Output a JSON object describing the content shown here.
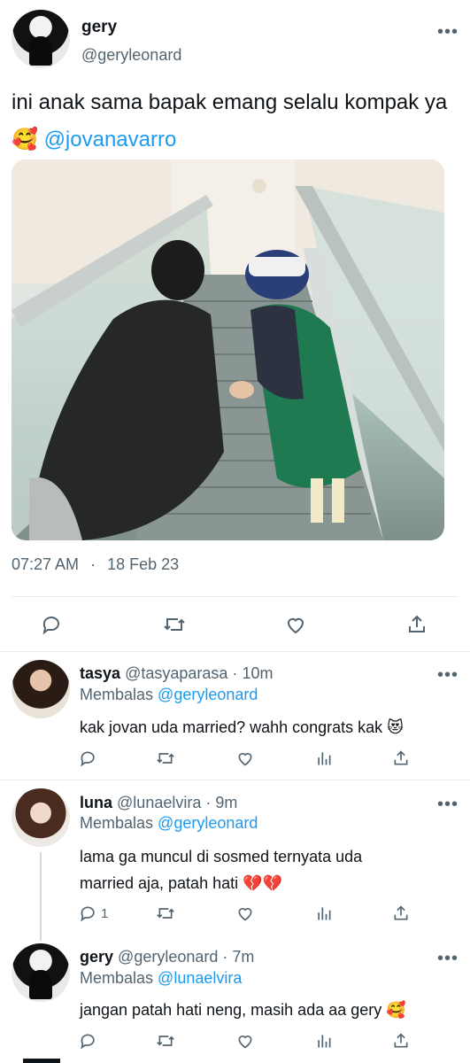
{
  "main_tweet": {
    "name": "gery",
    "handle": "@geryleonard",
    "text": "ini anak sama bapak emang selalu kompak ya 🥰",
    "mention": "@jovanavarro",
    "time": "07:27 AM",
    "separator": "·",
    "date": "18 Feb 23"
  },
  "replies": [
    {
      "name": "tasya",
      "handle": "@tasyaparasa",
      "time_sep": "·",
      "time": "10m",
      "reply_to_label": "Membalas",
      "reply_to": "@geryleonard",
      "text": "kak jovan uda married? wahh congrats kak 😻",
      "reply_count": ""
    },
    {
      "name": "luna",
      "handle": "@lunaelvira",
      "time_sep": "·",
      "time": "9m",
      "reply_to_label": "Membalas",
      "reply_to": "@geryleonard",
      "text": "lama ga muncul di sosmed ternyata uda married aja, patah hati 💔💔",
      "reply_count": "1"
    },
    {
      "name": "gery",
      "handle": "@geryleonard",
      "time_sep": "·",
      "time": "7m",
      "reply_to_label": "Membalas",
      "reply_to": "@lunaelvira",
      "text": "jangan patah hati neng, masih ada aa gery 🥰",
      "reply_count": ""
    }
  ],
  "icons": {
    "more": "more-icon",
    "reply": "reply-icon",
    "retweet": "retweet-icon",
    "like": "heart-icon",
    "share": "share-icon",
    "stats": "stats-icon"
  },
  "colors": {
    "accent": "#1d9bf0",
    "muted": "#536471",
    "text": "#0f1419",
    "divider": "#e6ecf0"
  }
}
